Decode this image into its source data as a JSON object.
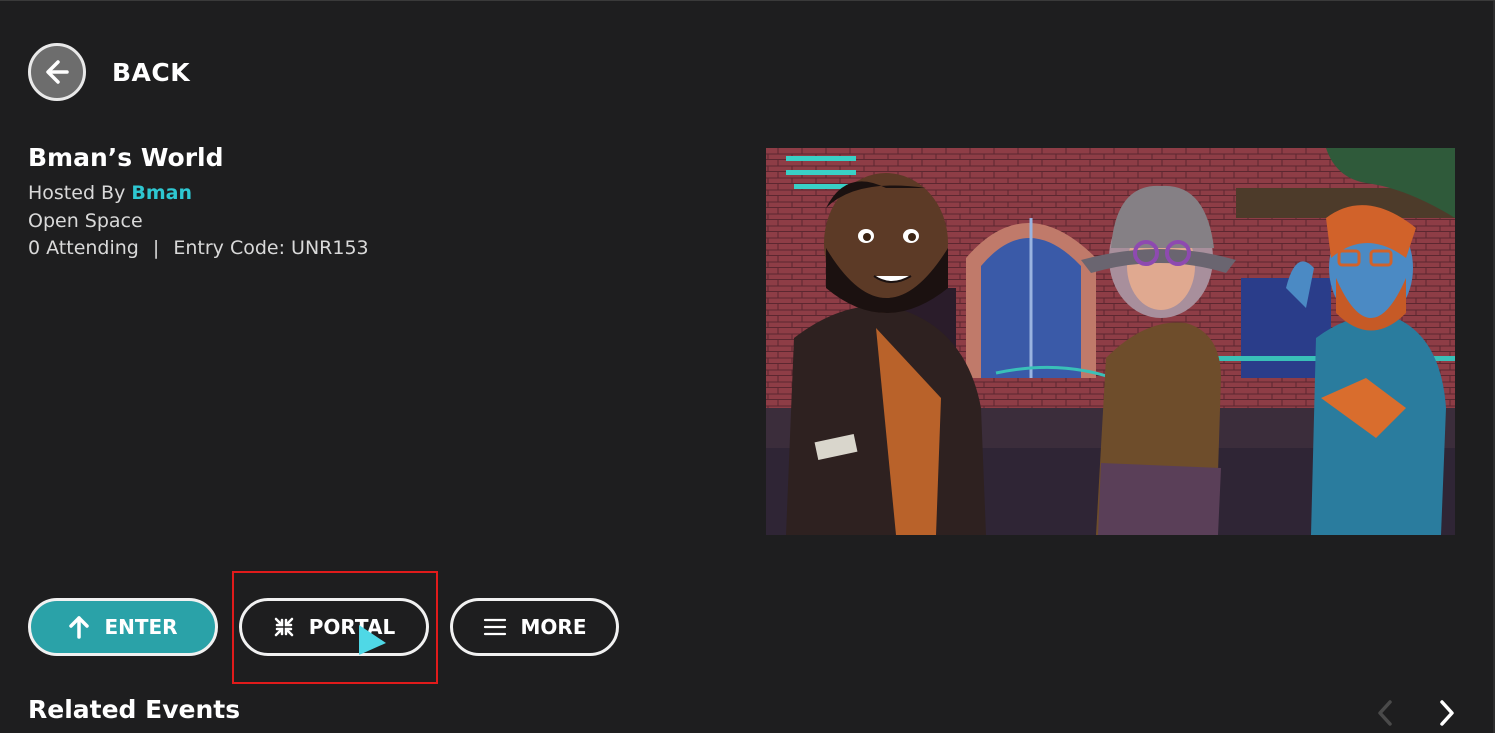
{
  "nav": {
    "back_label": "BACK"
  },
  "event": {
    "title": "Bman’s World",
    "hosted_by_label": "Hosted By",
    "host_name": "Bman",
    "space_type": "Open Space",
    "attending": "0 Attending",
    "separator": "|",
    "entry_code": "Entry Code: UNR153"
  },
  "actions": {
    "enter_label": "ENTER",
    "portal_label": "PORTAL",
    "more_label": "MORE"
  },
  "related": {
    "title": "Related Events"
  },
  "colors": {
    "accent_teal": "#2aa2a8",
    "host_link": "#2ec7d1",
    "highlight_box": "#e01b1b",
    "background": "#1e1e1f"
  }
}
